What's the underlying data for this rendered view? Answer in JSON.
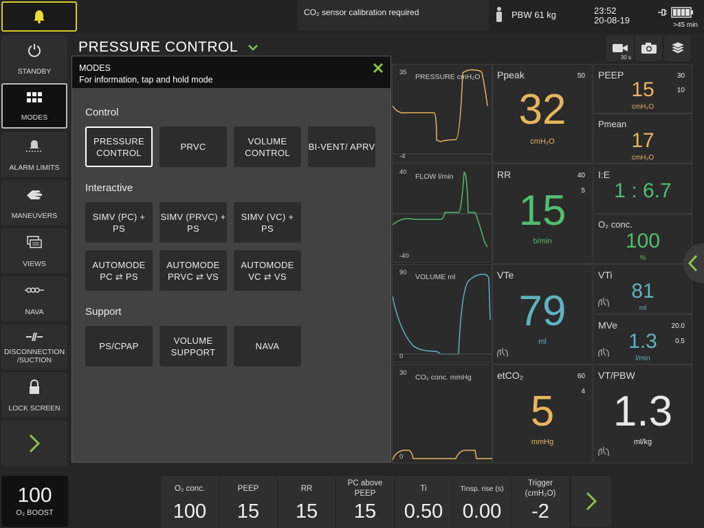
{
  "top_bar": {
    "alarm_message": "CO₂ sensor calibration required",
    "pbw": "PBW 61 kg",
    "time": "23:52",
    "date": "20-08-19",
    "battery_time": ">45 min"
  },
  "sidebar": {
    "items": [
      {
        "label": "STANDBY",
        "icon": "power-icon"
      },
      {
        "label": "MODES",
        "icon": "grid-icon"
      },
      {
        "label": "ALARM LIMITS",
        "icon": "alarm-limits-icon"
      },
      {
        "label": "MANEUVERS",
        "icon": "hand-icon"
      },
      {
        "label": "VIEWS",
        "icon": "views-icon"
      },
      {
        "label": "NAVA",
        "icon": "nava-icon"
      },
      {
        "label": "DISCONNECTION /SUCTION",
        "icon": "disconnect-icon"
      },
      {
        "label": "LOCK SCREEN",
        "icon": "lock-icon"
      }
    ]
  },
  "header": {
    "mode_title": "PRESSURE CONTROL",
    "camera_timer": "30 s"
  },
  "modes_dialog": {
    "title": "MODES",
    "subtitle": "For information, tap and hold mode",
    "sections": {
      "control": "Control",
      "interactive": "Interactive",
      "support": "Support"
    },
    "control_buttons": [
      "PRESSURE CONTROL",
      "PRVC",
      "VOLUME CONTROL",
      "BI-VENT/ APRV"
    ],
    "interactive_buttons": [
      "SIMV (PC) + PS",
      "SIMV (PRVC) + PS",
      "SIMV (VC) + PS",
      "AUTOMODE PC ⇄ PS",
      "AUTOMODE PRVC ⇄ VS",
      "AUTOMODE VC ⇄ VS"
    ],
    "support_buttons": [
      "PS/CPAP",
      "VOLUME SUPPORT",
      "NAVA"
    ]
  },
  "waveforms": {
    "pressure": {
      "label": "PRESSURE cmH₂O",
      "max": "35",
      "min": "-4"
    },
    "flow": {
      "label": "FLOW l/min",
      "max": "40",
      "min": "-40"
    },
    "volume": {
      "label": "VOLUME ml",
      "max": "90",
      "min": "0"
    },
    "co2": {
      "label": "CO₂ conc. mmHg",
      "max": "30",
      "min": "0"
    }
  },
  "measured": {
    "ppeak": {
      "name": "Ppeak",
      "value": "32",
      "unit": "cmH₂O",
      "hi": "50"
    },
    "peep": {
      "name": "PEEP",
      "value": "15",
      "unit": "cmH₂O",
      "hi": "30",
      "lo": "10"
    },
    "pmean": {
      "name": "Pmean",
      "value": "17",
      "unit": "cmH₂O"
    },
    "rr": {
      "name": "RR",
      "value": "15",
      "unit": "b/min",
      "hi": "40",
      "lo": "5"
    },
    "ie": {
      "name": "I:E",
      "value": "1 : 6.7"
    },
    "o2": {
      "name": "O₂ conc.",
      "value": "100",
      "unit": "%"
    },
    "vte": {
      "name": "VTe",
      "value": "79",
      "unit": "ml"
    },
    "vti": {
      "name": "VTi",
      "value": "81",
      "unit": "ml"
    },
    "mve": {
      "name": "MVe",
      "value": "1.3",
      "unit": "l/min",
      "hi": "20.0",
      "lo": "0.5"
    },
    "etco2": {
      "name": "etCO₂",
      "value": "5",
      "unit": "mmHg",
      "hi": "60",
      "lo": "4"
    },
    "vtpbw": {
      "name": "VT/PBW",
      "value": "1.3",
      "unit": "ml/kg"
    }
  },
  "bottom_bar": {
    "boost": {
      "value": "100",
      "label": "O₂ BOOST"
    },
    "settings": [
      {
        "label": "O₂ conc.",
        "value": "100"
      },
      {
        "label": "PEEP",
        "value": "15"
      },
      {
        "label": "RR",
        "value": "15"
      },
      {
        "label": "PC above PEEP",
        "value": "15"
      },
      {
        "label": "Ti",
        "value": "0.50"
      },
      {
        "label": "Tinsp. rise (s)",
        "value": "0.00"
      },
      {
        "label": "Trigger (cmH₂O)",
        "value": "-2"
      }
    ]
  },
  "colors": {
    "alarm_border": "#d8cc2a",
    "pressure": "#e8b55d",
    "flow_volume_green": "#4fbf6e",
    "volume_blue": "#5eb3c0",
    "accent_green": "#8bc34a"
  }
}
